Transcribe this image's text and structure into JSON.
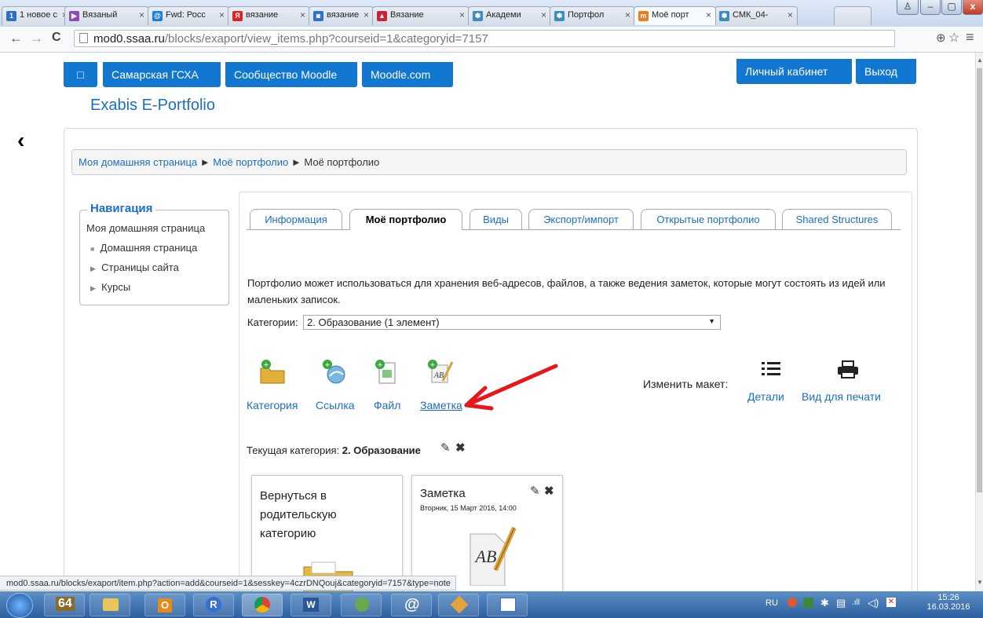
{
  "browser": {
    "tabs": [
      {
        "label": "1 новое с",
        "color": "#2d6fc1",
        "glyph": "1"
      },
      {
        "label": "Вязаный",
        "color": "#8a4bb5",
        "glyph": "▶"
      },
      {
        "label": "Fwd: Росс",
        "color": "#1a7fd6",
        "glyph": "@"
      },
      {
        "label": "вязание",
        "color": "#d22",
        "glyph": "Я"
      },
      {
        "label": "вязание",
        "color": "#2a73c9",
        "glyph": "◙"
      },
      {
        "label": "Вязание",
        "color": "#c23",
        "glyph": "▲"
      },
      {
        "label": "Академи",
        "color": "#3c8dbc",
        "glyph": "❃"
      },
      {
        "label": "Портфол",
        "color": "#3c8dbc",
        "glyph": "❃"
      },
      {
        "label": "Моё порт",
        "color": "#e67e22",
        "glyph": "m"
      },
      {
        "label": "СМК_04-",
        "color": "#3c8dbc",
        "glyph": "❃"
      }
    ],
    "url_host": "mod0.ssaa.ru",
    "url_path": "/blocks/exaport/view_items.php?courseid=1&categoryid=7157",
    "back_icon": "←",
    "forward_icon": "→",
    "reload_icon": "C",
    "zoom_icon": "⊕",
    "star_icon": "☆",
    "menu_icon": "≡"
  },
  "topnav": {
    "home_label": "□",
    "items": [
      "Самарская ГСХА",
      "Сообщество Moodle",
      "Moodle.com"
    ],
    "cabinet_label": "Личный кабинет",
    "logout_label": "Выход"
  },
  "page_title": "Exabis E-Portfolio",
  "breadcrumb": {
    "home": "Моя домашняя страница",
    "sep": "►",
    "portfolio": "Моё портфолио",
    "current": "Моё портфолио"
  },
  "navigation": {
    "title": "Навигация",
    "home": "Моя домашняя страница",
    "items": [
      "Домашняя страница",
      "Страницы сайта",
      "Курсы"
    ]
  },
  "tabs": [
    "Информация",
    "Моё портфолио",
    "Виды",
    "Экспорт/импорт",
    "Открытые портфолио",
    "Shared Structures"
  ],
  "intro": "Портфолио может использоваться для хранения веб-адресов, файлов, а также ведения заметок, которые могут состоять из идей или маленьких записок.",
  "category_select": {
    "label": "Категории:",
    "value": "2. Образование (1 элемент)"
  },
  "actions": {
    "category": "Категория",
    "link": "Ссылка",
    "file": "Файл",
    "note": "Заметка"
  },
  "layout": {
    "change_label": "Изменить макет:",
    "details": "Детали",
    "print": "Вид для печати"
  },
  "current_category": {
    "label": "Текущая категория:",
    "name": "2. Образование"
  },
  "cards": {
    "back": "Вернуться в родительскую категорию",
    "note_title": "Заметка",
    "note_date": "Вторник, 15 Март 2016, 14:00"
  },
  "status_url": "mod0.ssaa.ru/blocks/exaport/item.php?action=add&courseid=1&sesskey=4czrDNQouj&categoryid=7157&type=note",
  "taskbar": {
    "lang": "RU",
    "time": "15:26",
    "date": "16.03.2016"
  },
  "colors": {
    "primary": "#1177d1",
    "link": "#1a6ec8",
    "arrow": "#e8161c"
  }
}
